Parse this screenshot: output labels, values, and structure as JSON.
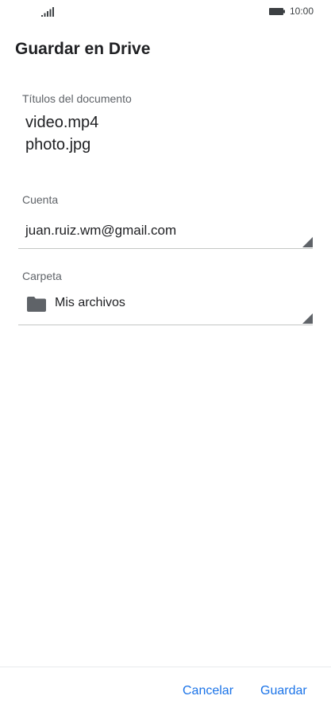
{
  "status_bar": {
    "time": "10:00",
    "icons": [
      "signal-icon",
      "battery-icon"
    ]
  },
  "dialog": {
    "title": "Guardar en Drive",
    "documents": {
      "label": "Títulos del documento",
      "items": [
        "video.mp4",
        "photo.jpg"
      ]
    },
    "account": {
      "label": "Cuenta",
      "value": "juan.ruiz.wm@gmail.com"
    },
    "folder": {
      "label": "Carpeta",
      "value": "Mis archivos",
      "icon": "folder-icon"
    }
  },
  "actions": {
    "cancel_label": "Cancelar",
    "save_label": "Guardar"
  },
  "colors": {
    "accent": "#1a73e8",
    "label": "#5f6368",
    "text": "#202124",
    "icon": "#5f6368"
  }
}
